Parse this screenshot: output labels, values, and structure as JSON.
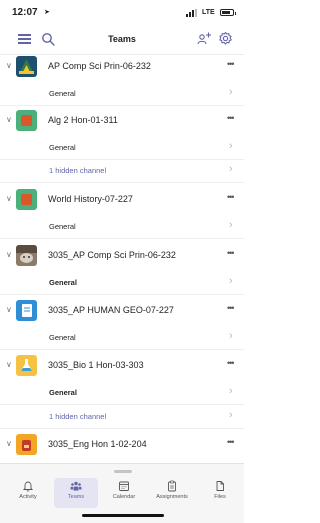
{
  "status_bar": {
    "time": "12:07",
    "location_icon": "location-arrow-icon",
    "carrier": "LTE"
  },
  "header": {
    "title": "Teams"
  },
  "teams": [
    {
      "name": "AP Comp Sci Prin-06-232",
      "avatar": "wizard-hat",
      "color": "#1d4f6e",
      "channels": [
        {
          "label": "General",
          "style": "normal"
        }
      ]
    },
    {
      "name": "Alg 2 Hon-01-311",
      "avatar": "orange-square",
      "color": "#4cb07a",
      "channels": [
        {
          "label": "General",
          "style": "normal"
        },
        {
          "label": "1 hidden channel",
          "style": "link"
        }
      ]
    },
    {
      "name": "World History-07-227",
      "avatar": "orange-square",
      "color": "#4cb07a",
      "channels": [
        {
          "label": "General",
          "style": "normal"
        }
      ]
    },
    {
      "name": "3035_AP Comp Sci Prin-06-232",
      "avatar": "photo-cat",
      "color": "#7a6a5a",
      "channels": [
        {
          "label": "General",
          "style": "bold"
        }
      ]
    },
    {
      "name": "3035_AP HUMAN GEO-07-227",
      "avatar": "document",
      "color": "#2f8fd6",
      "channels": [
        {
          "label": "General",
          "style": "normal"
        }
      ]
    },
    {
      "name": "3035_Bio 1 Hon-03-303",
      "avatar": "flask",
      "color": "#f5c243",
      "channels": [
        {
          "label": "General",
          "style": "bold"
        },
        {
          "label": "1 hidden channel",
          "style": "link"
        }
      ]
    },
    {
      "name": "3035_Eng Hon 1-02-204",
      "avatar": "backpack",
      "color": "#f2a623",
      "channels": []
    }
  ],
  "bottom_nav": [
    {
      "label": "Activity",
      "icon": "bell-icon",
      "active": false
    },
    {
      "label": "Teams",
      "icon": "teams-icon",
      "active": true
    },
    {
      "label": "Calendar",
      "icon": "calendar-icon",
      "active": false
    },
    {
      "label": "Assignments",
      "icon": "assignments-icon",
      "active": false
    },
    {
      "label": "Files",
      "icon": "files-icon",
      "active": false
    }
  ],
  "colors": {
    "accent": "#6264a7",
    "nav_active_bg": "#e4e4f3"
  }
}
